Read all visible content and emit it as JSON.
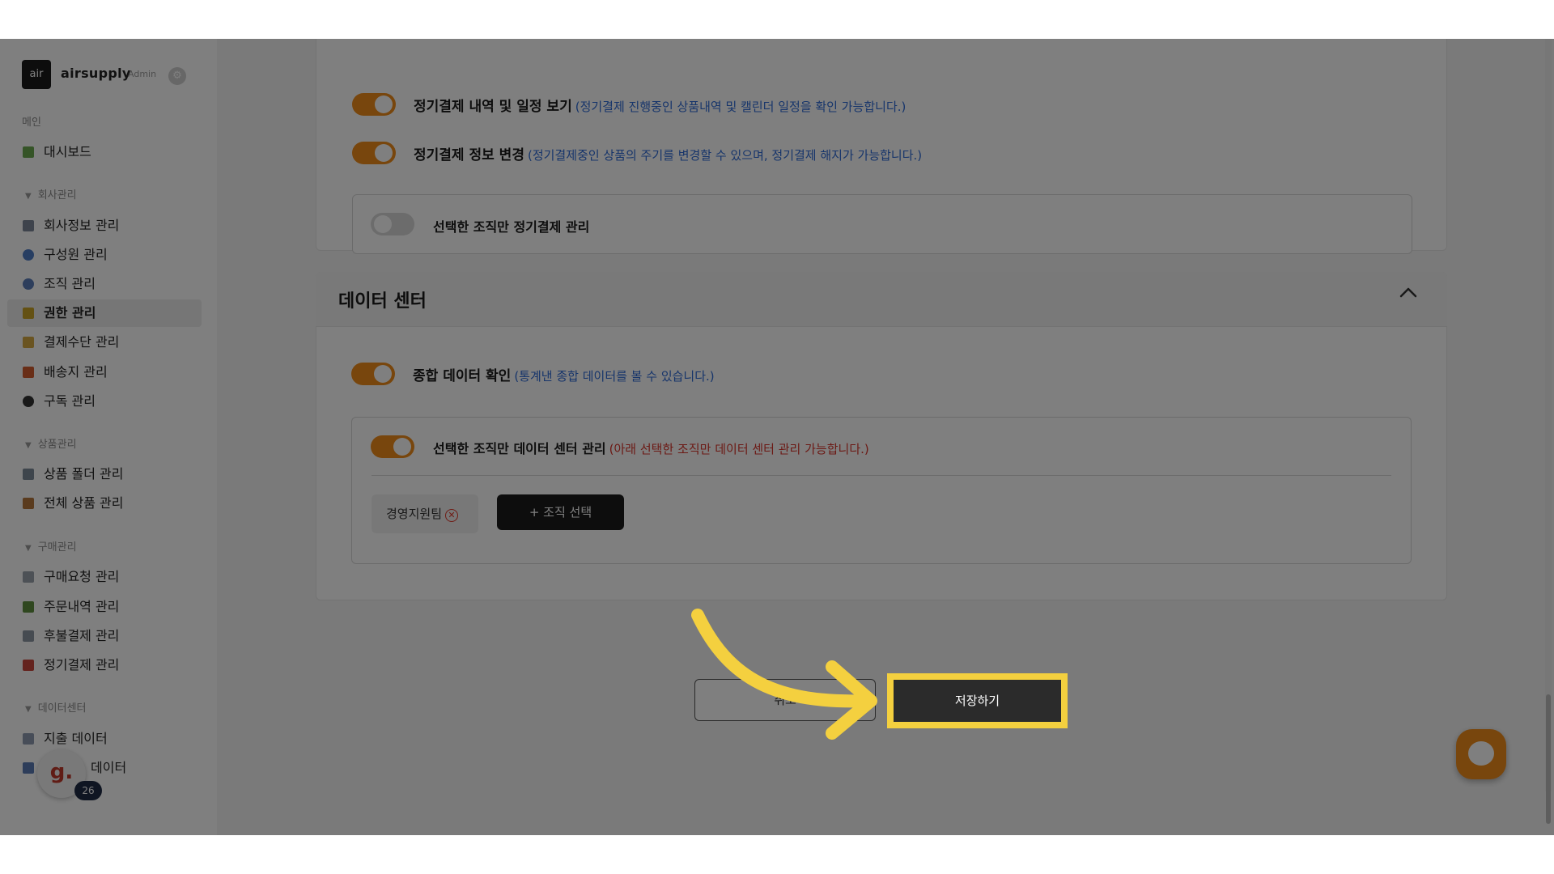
{
  "app": {
    "logo_text": "air",
    "brand": "airsupply",
    "brand_sub": "Admin"
  },
  "sidebar": {
    "main_label": "메인",
    "dashboard": "대시보드",
    "groups": [
      {
        "label": "회사관리",
        "items": [
          "회사정보 관리",
          "구성원 관리",
          "조직 관리",
          "권한 관리",
          "결제수단 관리",
          "배송지 관리",
          "구독 관리"
        ]
      },
      {
        "label": "상품관리",
        "items": [
          "상품 폴더 관리",
          "전체 상품 관리"
        ]
      },
      {
        "label": "구매관리",
        "items": [
          "구매요청 관리",
          "주문내역 관리",
          "후불결제 관리",
          "정기결제 관리"
        ]
      },
      {
        "label": "데이터센터",
        "items": [
          "지출 데이터",
          "데이터"
        ]
      }
    ],
    "active_item": "권한 관리",
    "avatar_letter": "g.",
    "avatar_badge": "26"
  },
  "subscription_section": {
    "perm_view": {
      "title": "정기결제 내역 및 일정 보기",
      "desc": "(정기결제 진행중인 상품내역 및 캘린더 일정을 확인 가능합니다.)",
      "on": true
    },
    "perm_change": {
      "title": "정기결제 정보 변경",
      "desc": "(정기결제중인 상품의 주기를 변경할 수 있으며, 정기결제 해지가 가능합니다.)",
      "on": true
    },
    "org_only": {
      "title": "선택한 조직만 정기결제 관리",
      "on": false
    }
  },
  "data_center_section": {
    "title": "데이터 센터",
    "perm_summary": {
      "title": "종합 데이터 확인",
      "desc": "(통계낸 종합 데이터를 볼 수 있습니다.)",
      "on": true
    },
    "org_only": {
      "title": "선택한 조직만 데이터 센터 관리",
      "desc": "(아래 선택한 조직만 데이터 센터 관리 가능합니다.)",
      "on": true
    },
    "chip_label": "경영지원팀",
    "select_org_button": "+ 조직 선택"
  },
  "footer": {
    "cancel_label": "취소",
    "save_label": "저장하기"
  },
  "colors": {
    "toggle_on": "#f08c1a",
    "highlight": "#f4d03f",
    "desc_blue": "#2e6bd6",
    "desc_red": "#d9342b"
  }
}
